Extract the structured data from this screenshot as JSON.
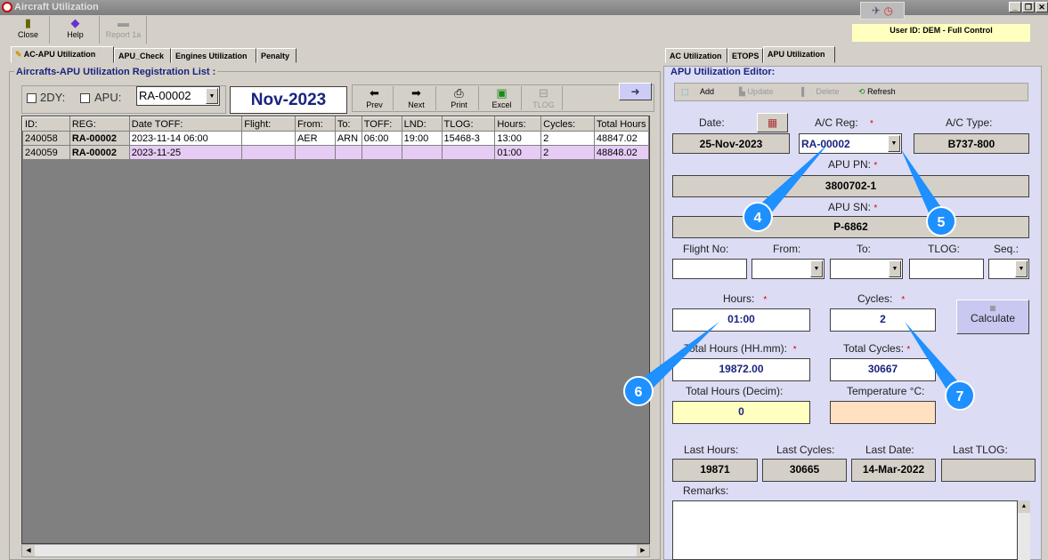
{
  "window": {
    "title": "Aircraft Utilization",
    "min": "_",
    "restore": "❐",
    "close": "✕"
  },
  "toolbar": {
    "close": "Close",
    "help": "Help",
    "report": "Report 1a"
  },
  "user": {
    "label": "User ID: DEM - Full Control"
  },
  "left_tabs": [
    "AC-APU Utilization",
    "APU_Check",
    "Engines Utilization",
    "Penalty"
  ],
  "right_tabs": [
    "AC Utilization",
    "ETOPS",
    "APU Utilization"
  ],
  "list": {
    "title": "Aircrafts-APU Utilization Registration List :",
    "chk_2dy": "2DY:",
    "chk_apu": "APU:",
    "reg_select": "RA-00002",
    "month": "Nov-2023",
    "buttons": {
      "prev": "Prev",
      "next": "Next",
      "print": "Print",
      "excel": "Excel",
      "tlog": "TLOG"
    },
    "columns": [
      "ID:",
      "REG:",
      "Date TOFF:",
      "Flight:",
      "From:",
      "To:",
      "TOFF:",
      "LND:",
      "TLOG:",
      "Hours:",
      "Cycles:",
      "Total Hours"
    ],
    "rows": [
      [
        "240058",
        "RA-00002",
        "2023-11-14 06:00",
        "",
        "AER",
        "ARN",
        "06:00",
        "19:00",
        "15468-3",
        "13:00",
        "2",
        "48847.02"
      ],
      [
        "240059",
        "RA-00002",
        "2023-11-25",
        "",
        "",
        "",
        "",
        "",
        "",
        "01:00",
        "2",
        "48848.02"
      ]
    ]
  },
  "editor": {
    "title": "APU Utilization Editor:",
    "add": "Add",
    "update": "Update",
    "delete": "Delete",
    "refresh": "Refresh",
    "date_label": "Date:",
    "date": "25-Nov-2023",
    "reg_label": "A/C Reg:",
    "reg": "RA-00002",
    "type_label": "A/C Type:",
    "type": "B737-800",
    "pn_label": "APU PN:",
    "pn": "3800702-1",
    "sn_label": "APU SN:",
    "sn": "P-6862",
    "flight_label": "Flight No:",
    "from_label": "From:",
    "to_label": "To:",
    "tlog_label": "TLOG:",
    "seq_label": "Seq.:",
    "hours_label": "Hours:",
    "hours": "01:00",
    "cycles_label": "Cycles:",
    "cycles": "2",
    "calculate": "Calculate",
    "total_hours_label": "Total Hours (HH.mm):",
    "total_hours": "19872.00",
    "total_cycles_label": "Total Cycles:",
    "total_cycles": "30667",
    "decim_label": "Total Hours (Decim):",
    "decim": "0",
    "temp_label": "Temperature °C:",
    "last_hours_label": "Last Hours:",
    "last_hours": "19871",
    "last_cycles_label": "Last Cycles:",
    "last_cycles": "30665",
    "last_date_label": "Last Date:",
    "last_date": "14-Mar-2022",
    "last_tlog_label": "Last TLOG:",
    "remarks_label": "Remarks:",
    "required": "*"
  },
  "callouts": [
    "4",
    "5",
    "6",
    "7"
  ]
}
